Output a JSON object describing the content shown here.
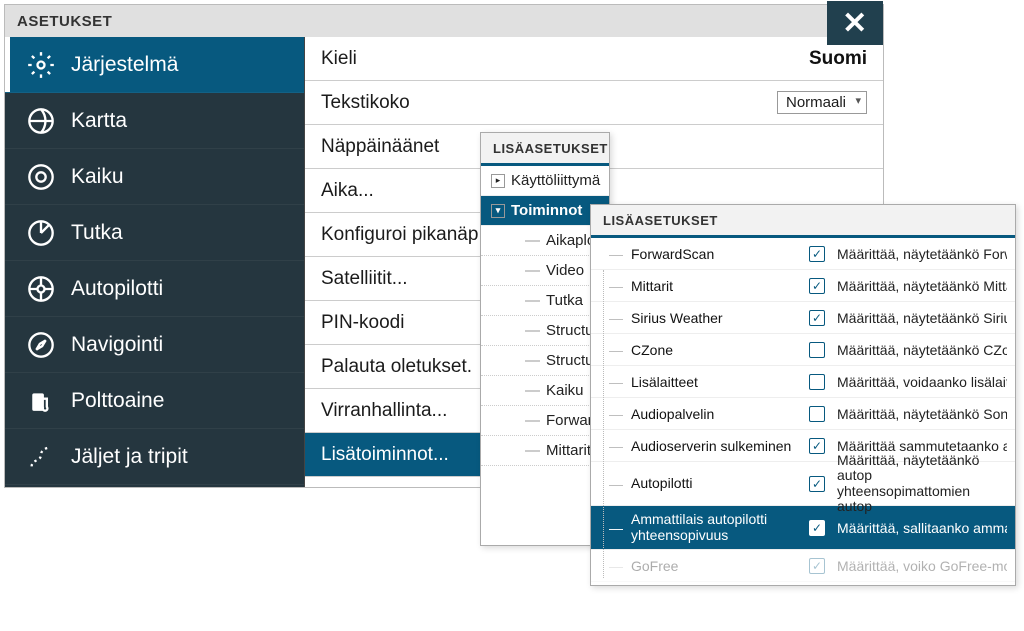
{
  "header": {
    "title": "ASETUKSET"
  },
  "sidebar": {
    "items": [
      {
        "id": "system",
        "label": "Järjestelmä",
        "icon": "gear"
      },
      {
        "id": "chart",
        "label": "Kartta",
        "icon": "globe"
      },
      {
        "id": "echo",
        "label": "Kaiku",
        "icon": "fish"
      },
      {
        "id": "radar",
        "label": "Tutka",
        "icon": "radar"
      },
      {
        "id": "autopilot",
        "label": "Autopilotti",
        "icon": "wheel"
      },
      {
        "id": "navigation",
        "label": "Navigointi",
        "icon": "compass"
      },
      {
        "id": "fuel",
        "label": "Polttoaine",
        "icon": "fuel"
      },
      {
        "id": "tracks",
        "label": "Jäljet ja tripit",
        "icon": "route"
      }
    ]
  },
  "main": {
    "rows": [
      {
        "label": "Kieli",
        "value": "Suomi",
        "type": "text"
      },
      {
        "label": "Tekstikoko",
        "value": "Normaali",
        "type": "select"
      },
      {
        "label": "Näppäinäänet",
        "type": "link"
      },
      {
        "label": "Aika...",
        "type": "link"
      },
      {
        "label": "Konfiguroi pikanäp",
        "type": "link"
      },
      {
        "label": "Satelliitit...",
        "type": "link"
      },
      {
        "label": "PIN-koodi",
        "type": "link"
      },
      {
        "label": "Palauta oletukset.",
        "type": "link"
      },
      {
        "label": "Virranhallinta...",
        "type": "link"
      },
      {
        "label": "Lisätoiminnot...",
        "type": "link",
        "selected": true
      }
    ]
  },
  "popup1": {
    "title": "LISÄASETUKSET",
    "tree": {
      "root1": "Käyttöliittymä",
      "root2": "Toiminnot",
      "children": [
        "Aikaplotta",
        "Video",
        "Tutka",
        "Structure",
        "StructureS",
        "Kaiku",
        "ForwardS",
        "Mittarit"
      ]
    }
  },
  "popup2": {
    "title": "LISÄASETUKSET",
    "rows": [
      {
        "name": "ForwardScan",
        "checked": true,
        "desc": "Määrittää, näytetäänkö Forw"
      },
      {
        "name": "Mittarit",
        "checked": true,
        "desc": "Määrittää, näytetäänkö Mitta"
      },
      {
        "name": "Sirius Weather",
        "checked": true,
        "desc": "Määrittää, näytetäänkö Sirius"
      },
      {
        "name": "CZone",
        "checked": false,
        "desc": "Määrittää, näytetäänkö CZone"
      },
      {
        "name": "Lisälaitteet",
        "checked": false,
        "desc": "Määrittää, voidaanko lisälait"
      },
      {
        "name": "Audiopalvelin",
        "checked": false,
        "desc": "Määrittää, näytetäänkö Soni"
      },
      {
        "name": "Audioserverin sulkeminen",
        "checked": true,
        "desc": "Määrittää sammutetaanko a"
      },
      {
        "name": "Autopilotti",
        "checked": true,
        "desc": "Määrittää, näytetäänkö autop\nyhteensopimattomien autop"
      },
      {
        "name": "Ammattilais autopilotti yhteensopivuus",
        "checked": true,
        "desc": "Määrittää, sallitaanko amma",
        "selected": true
      },
      {
        "name": "GoFree",
        "checked": true,
        "desc": "Määrittää, voiko GoFree-mo",
        "dim": true
      }
    ]
  }
}
